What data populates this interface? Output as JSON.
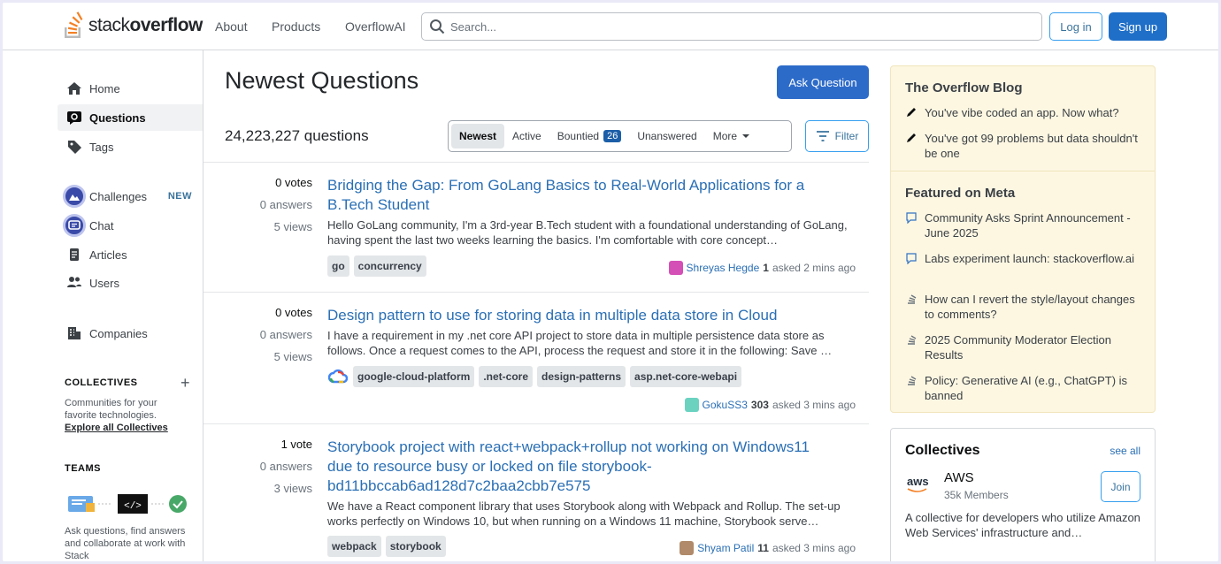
{
  "header": {
    "logo_text_regular": "stack",
    "logo_text_bold": "overflow",
    "nav": [
      "About",
      "Products",
      "OverflowAI"
    ],
    "search_placeholder": "Search...",
    "login_label": "Log in",
    "signup_label": "Sign up"
  },
  "sidebar": {
    "items": [
      {
        "label": "Home",
        "icon": "home-icon"
      },
      {
        "label": "Questions",
        "icon": "questions-icon"
      },
      {
        "label": "Tags",
        "icon": "tag-icon"
      },
      {
        "label": "Challenges",
        "icon": "challenges-icon",
        "badge": "NEW"
      },
      {
        "label": "Chat",
        "icon": "chat-icon"
      },
      {
        "label": "Articles",
        "icon": "articles-icon"
      },
      {
        "label": "Users",
        "icon": "users-icon"
      },
      {
        "label": "Companies",
        "icon": "companies-icon"
      }
    ],
    "collectives_heading": "COLLECTIVES",
    "collectives_text": "Communities for your favorite technologies.",
    "collectives_link": "Explore all Collectives",
    "teams_heading": "TEAMS",
    "teams_text": "Ask questions, find answers and collaborate at work with Stack"
  },
  "main": {
    "title": "Newest Questions",
    "ask_button": "Ask Question",
    "question_count": "24,223,227 questions",
    "tabs": [
      {
        "label": "Newest",
        "active": true
      },
      {
        "label": "Active"
      },
      {
        "label": "Bountied",
        "count": "26"
      },
      {
        "label": "Unanswered"
      },
      {
        "label": "More"
      }
    ],
    "filter_label": "Filter",
    "questions": [
      {
        "votes": "0 votes",
        "answers": "0 answers",
        "views": "5 views",
        "title": "Bridging the Gap: From GoLang Basics to Real-World Applications for a B.Tech Student",
        "excerpt": "Hello GoLang community, I'm a 3rd-year B.Tech student with a foundational understanding of GoLang, having spent the last two weeks learning the basics. I'm comfortable with core concept…",
        "tags": [
          "go",
          "concurrency"
        ],
        "user": "Shreyas Hegde",
        "rep": "1",
        "asked": "asked 2 mins ago",
        "avatar_color": "#d44fb6"
      },
      {
        "votes": "0 votes",
        "answers": "0 answers",
        "views": "5 views",
        "title": "Design pattern to use for storing data in multiple data store in Cloud",
        "excerpt": "I have a requirement in my .net core API project to store data in multiple persistence data store as follows. Once a request comes to the API, process the request and store it in the following: Save …",
        "tags": [
          "google-cloud-platform",
          ".net-core",
          "design-patterns",
          "asp.net-core-webapi"
        ],
        "user": "GokuSS3",
        "rep": "303",
        "asked": "asked 3 mins ago",
        "avatar_color": "#6bd2c0"
      },
      {
        "votes": "1 vote",
        "answers": "0 answers",
        "views": "3 views",
        "title": "Storybook project with react+webpack+rollup not working on Windows11 due to resource busy or locked on file storybook-bd11bbccab6ad128d7c2baa2cbb7e575",
        "excerpt": "We have a React component library that uses Storybook along with Webpack and Rollup. The set-up works perfectly on Windows 10, but when running on a Windows 11 machine, Storybook serve…",
        "tags": [
          "webpack",
          "storybook"
        ],
        "user": "Shyam Patil",
        "rep": "11",
        "asked": "asked 3 mins ago",
        "avatar_color": "#b08a6a"
      }
    ]
  },
  "right": {
    "blog_heading": "The Overflow Blog",
    "blog_items": [
      "You've vibe coded an app. Now what?",
      "You've got 99 problems but data shouldn't be one"
    ],
    "meta_heading": "Featured on Meta",
    "meta_items": [
      "Community Asks Sprint Announcement - June 2025",
      "Labs experiment launch: stackoverflow.ai",
      "How can I revert the style/layout changes to comments?",
      "2025 Community Moderator Election Results",
      "Policy: Generative AI (e.g., ChatGPT) is banned"
    ],
    "collectives": {
      "title": "Collectives",
      "see_all": "see all",
      "logo_text": "aws",
      "name": "AWS",
      "members": "35k Members",
      "join": "Join",
      "description": "A collective for developers who utilize Amazon Web Services' infrastructure and…"
    }
  },
  "colors": {
    "accent": "#2d6bc9",
    "link": "#2a6fb5",
    "blog_bg": "#fdf7e2",
    "logo_orange": "#f48024"
  }
}
